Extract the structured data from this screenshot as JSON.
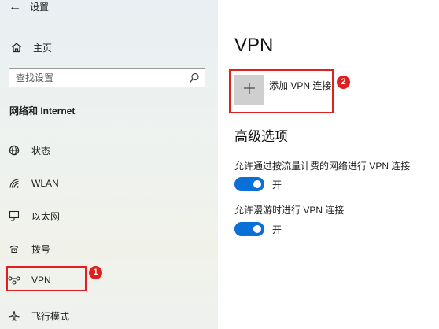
{
  "header": {
    "back_icon": "arrow-left-icon",
    "title": "设置"
  },
  "sidebar": {
    "home": {
      "label": "主页",
      "icon": "home-icon"
    },
    "search": {
      "placeholder": "查找设置",
      "icon": "search-icon"
    },
    "section_title": "网络和 Internet",
    "items": [
      {
        "label": "状态",
        "icon": "globe-status-icon"
      },
      {
        "label": "WLAN",
        "icon": "wifi-icon"
      },
      {
        "label": "以太网",
        "icon": "ethernet-icon"
      },
      {
        "label": "拨号",
        "icon": "dialup-icon"
      },
      {
        "label": "VPN",
        "icon": "vpn-icon"
      },
      {
        "label": "飞行模式",
        "icon": "airplane-icon"
      }
    ],
    "badge": "1"
  },
  "main": {
    "title": "VPN",
    "add_vpn": {
      "label": "添加 VPN 连接",
      "icon": "plus-icon",
      "badge": "2"
    },
    "advanced_title": "高级选项",
    "options": [
      {
        "label": "允许通过按流量计费的网络进行 VPN 连接",
        "state": "开",
        "on": true
      },
      {
        "label": "允许漫游时进行 VPN 连接",
        "state": "开",
        "on": true
      }
    ]
  },
  "colors": {
    "accent": "#0a6fd6",
    "highlight": "#e0201f"
  }
}
